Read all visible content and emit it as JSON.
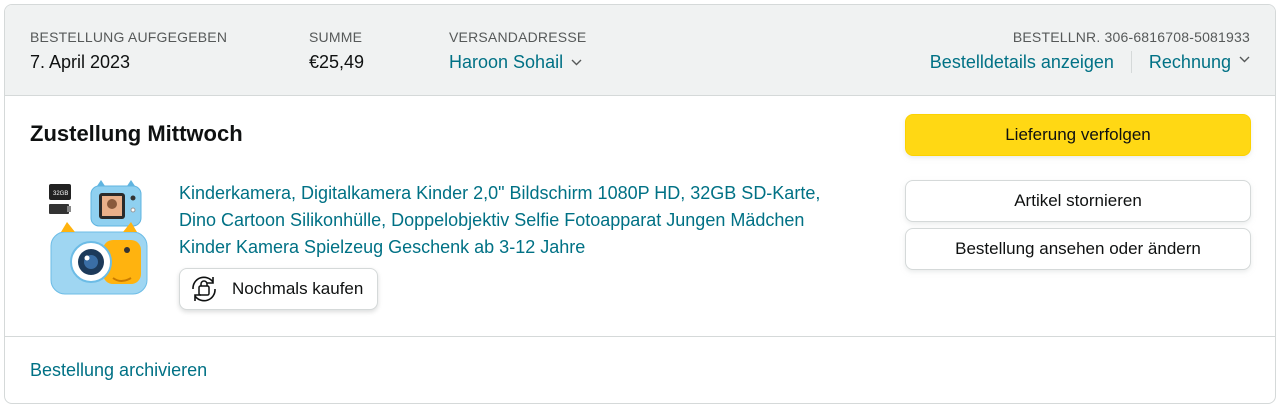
{
  "header": {
    "order_placed_label": "BESTELLUNG AUFGEGEBEN",
    "order_placed_value": "7. April 2023",
    "total_label": "SUMME",
    "total_value": "€25,49",
    "ship_to_label": "VERSANDADRESSE",
    "ship_to_value": "Haroon Sohail",
    "order_number_label": "BESTELLNR. 306-6816708-5081933",
    "order_details_link": "Bestelldetails anzeigen",
    "invoice_link": "Rechnung"
  },
  "shipment": {
    "delivery_status": "Zustellung Mittwoch",
    "product_title": "Kinderkamera, Digitalkamera Kinder 2,0\" Bildschirm 1080P HD, 32GB SD-Karte, Dino Cartoon Silikonhülle, Doppelobjektiv Selfie Fotoapparat Jungen Mädchen Kinder Kamera Spielzeug Geschenk ab 3-12 Jahre",
    "buy_again_label": "Nochmals kaufen",
    "product_image_sd_text": "32GB"
  },
  "actions": {
    "track_package": "Lieferung verfolgen",
    "cancel_items": "Artikel stornieren",
    "view_or_edit_order": "Bestellung ansehen oder ändern"
  },
  "footer": {
    "archive_link": "Bestellung archivieren"
  },
  "colors": {
    "link": "#007185",
    "header_bg": "#f0f2f2",
    "primary_button": "#ffd814",
    "border": "#d5d9d9"
  },
  "icons": {
    "dropdown": "chevron-down-icon",
    "buy_again": "buy-again-icon"
  }
}
